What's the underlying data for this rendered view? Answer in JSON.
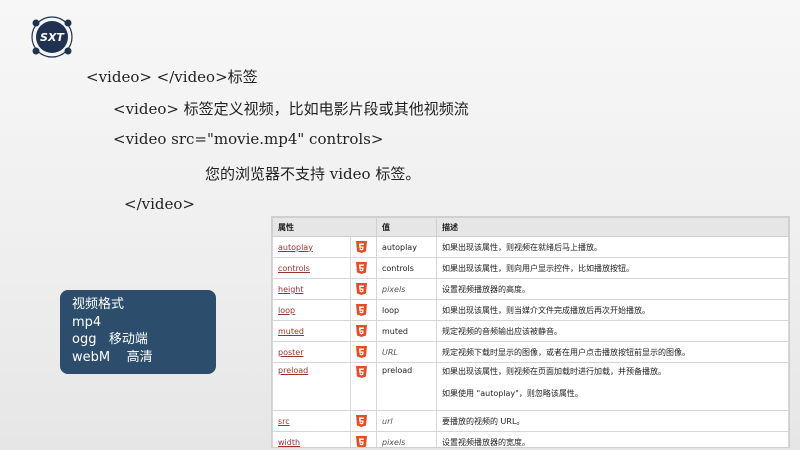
{
  "logo": {
    "text": "SXT"
  },
  "code_lines": {
    "line1": "<video> </video>标签",
    "line2": "<video> 标签定义视频，比如电影片段或其他视频流",
    "line3": "<video src=\"movie.mp4\" controls>",
    "line4": "您的浏览器不支持 video 标签。",
    "line5": "</video>"
  },
  "table": {
    "headers": [
      "属性",
      "值",
      "描述"
    ],
    "rows": [
      {
        "attr": "autoplay",
        "value": "autoplay",
        "desc": "如果出现该属性，则视频在就绪后马上播放。"
      },
      {
        "attr": "controls",
        "value": "controls",
        "desc": "如果出现该属性，则向用户显示控件，比如播放按钮。"
      },
      {
        "attr": "height",
        "value": "pixels",
        "desc": "设置视频播放器的高度。"
      },
      {
        "attr": "loop",
        "value": "loop",
        "desc": "如果出现该属性，则当媒介文件完成播放后再次开始播放。"
      },
      {
        "attr": "muted",
        "value": "muted",
        "desc": "规定视频的音频输出应该被静音。"
      },
      {
        "attr": "poster",
        "value": "URL",
        "desc": "规定视频下载时显示的图像，或者在用户点击播放按钮前显示的图像。"
      },
      {
        "attr": "preload",
        "value": "preload",
        "desc": "如果出现该属性，则视频在页面加载时进行加载，并预备播放。",
        "desc2": "如果使用 \"autoplay\"，则忽略该属性。"
      },
      {
        "attr": "src",
        "value": "url",
        "desc": "要播放的视频的 URL。"
      },
      {
        "attr": "width",
        "value": "pixels",
        "desc": "设置视频播放器的宽度。"
      }
    ]
  },
  "formats": {
    "title": "视频格式",
    "line1": "mp4",
    "line2": "ogg   移动端",
    "line3": "webM    高清"
  },
  "colors": {
    "link": "#99332b",
    "html5_badge": "#e44d26",
    "format_box": "#2c4d6b",
    "logo": "#1f3350"
  }
}
